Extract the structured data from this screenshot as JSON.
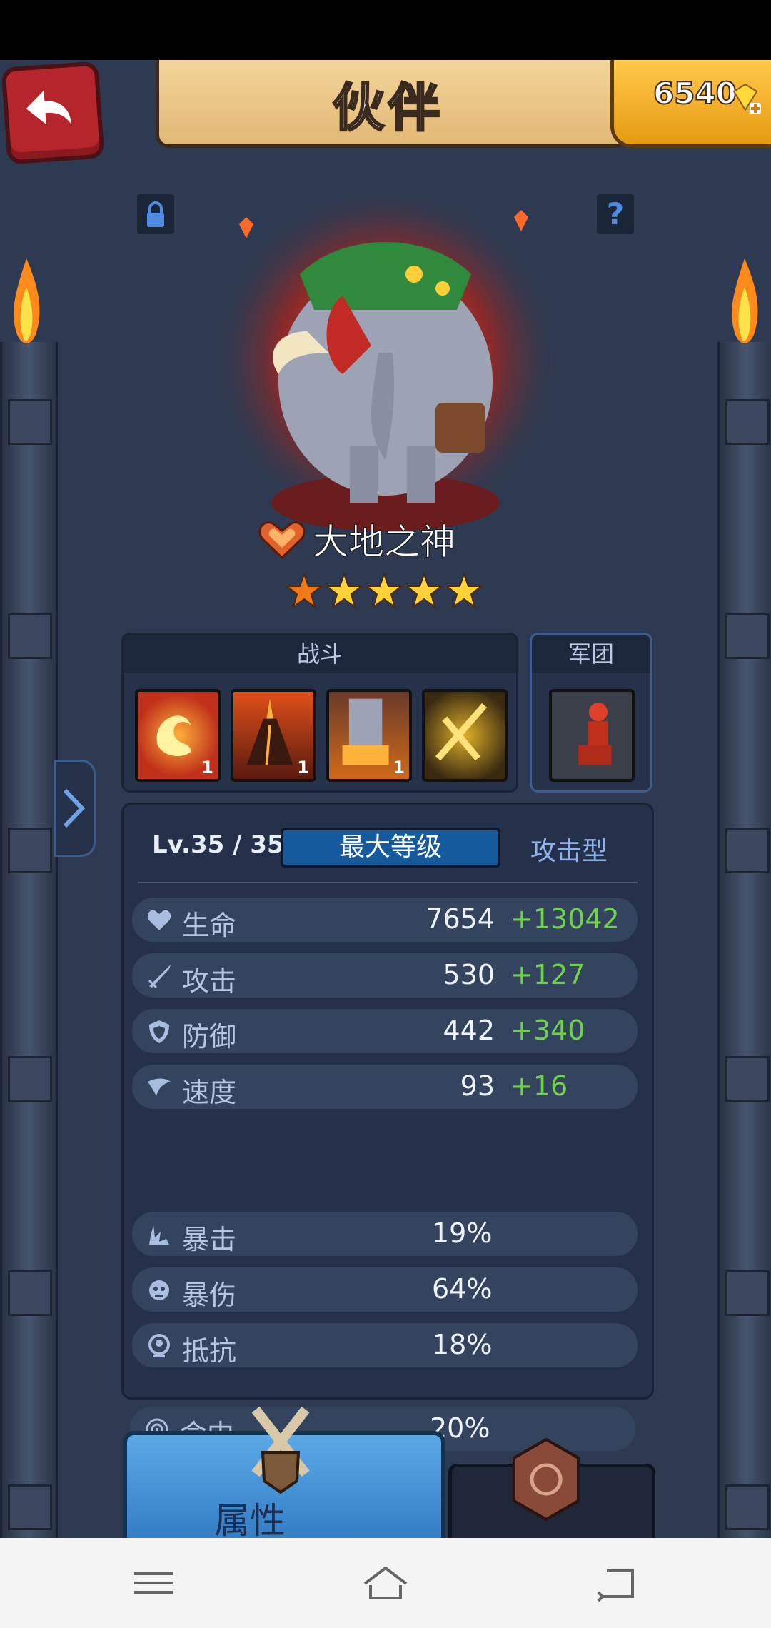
{
  "header": {
    "title": "伙伴",
    "gems": "6540"
  },
  "hero": {
    "name": "大地之神",
    "stars": 5
  },
  "combat_panel": {
    "title": "战斗",
    "skills": [
      {
        "icon": "fire-dragon-skill-icon",
        "level": "1"
      },
      {
        "icon": "volcano-skill-icon",
        "level": "1"
      },
      {
        "icon": "fire-pillar-skill-icon",
        "level": "1"
      },
      {
        "icon": "crossed-swords-skill-icon",
        "level": ""
      }
    ]
  },
  "legion_panel": {
    "title": "军团"
  },
  "stats": {
    "level": "Lv.35 / 35",
    "max_level": "最大等级",
    "type": "攻击型",
    "main": [
      {
        "icon": "heart-icon",
        "label": "生命",
        "value": "7654",
        "bonus": "+13042"
      },
      {
        "icon": "sword-icon",
        "label": "攻击",
        "value": "530",
        "bonus": "+127"
      },
      {
        "icon": "shield-icon",
        "label": "防御",
        "value": "442",
        "bonus": "+340"
      },
      {
        "icon": "wing-icon",
        "label": "速度",
        "value": "93",
        "bonus": "+16"
      }
    ],
    "secondary": [
      {
        "icon": "crit-icon",
        "label": "暴击",
        "value": "19%"
      },
      {
        "icon": "crit-damage-icon",
        "label": "暴伤",
        "value": "64%"
      },
      {
        "icon": "resist-icon",
        "label": "抵抗",
        "value": "18%"
      },
      {
        "icon": "target-icon",
        "label": "命中",
        "value": "20%"
      }
    ]
  },
  "tabs": {
    "attributes": "属性"
  },
  "colors": {
    "background": "#2d3a51",
    "bonus": "#6fd34a",
    "accent_blue": "#2f75c0"
  }
}
